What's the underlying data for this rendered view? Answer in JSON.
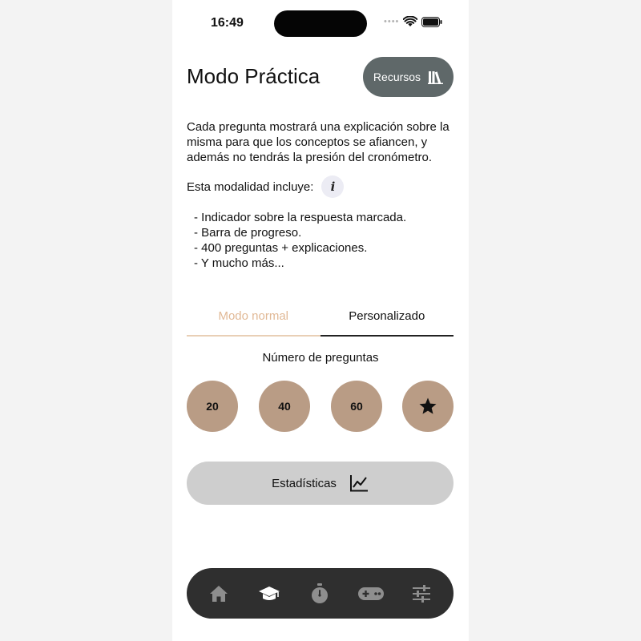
{
  "status_bar": {
    "time": "16:49",
    "signal": "••••",
    "icons": [
      "wifi-icon",
      "battery-icon"
    ]
  },
  "header": {
    "title": "Modo Práctica",
    "resources_label": "Recursos",
    "resources_icon": "books-icon"
  },
  "description": "Cada pregunta mostrará una explicación sobre la misma para que los conceptos se afiancen, y además no tendrás la presión del cronómetro.",
  "includes": {
    "label": "Esta modalidad incluye:",
    "info_icon_text": "i"
  },
  "features": [
    "- Indicador sobre la respuesta marcada.",
    "- Barra de progreso.",
    "- 400 preguntas + explicaciones.",
    "- Y mucho más..."
  ],
  "tabs": [
    {
      "label": "Modo normal",
      "selected": false
    },
    {
      "label": "Personalizado",
      "selected": true
    }
  ],
  "questions": {
    "label": "Número de preguntas",
    "options": [
      "20",
      "40",
      "60"
    ],
    "extra_icon": "star-icon"
  },
  "stats": {
    "label": "Estadísticas",
    "icon": "line-chart-icon"
  },
  "bottom_nav": {
    "items": [
      "home-icon",
      "graduation-cap-icon",
      "stopwatch-icon",
      "gamepad-icon",
      "sliders-icon"
    ],
    "active": "graduation-cap-icon"
  },
  "colors": {
    "resources_bg": "#5f6869",
    "count_bg": "#b99c85",
    "tab_normal": "#e1b996",
    "stats_bg": "#cecece",
    "nav_bg": "#2f2f2f"
  }
}
